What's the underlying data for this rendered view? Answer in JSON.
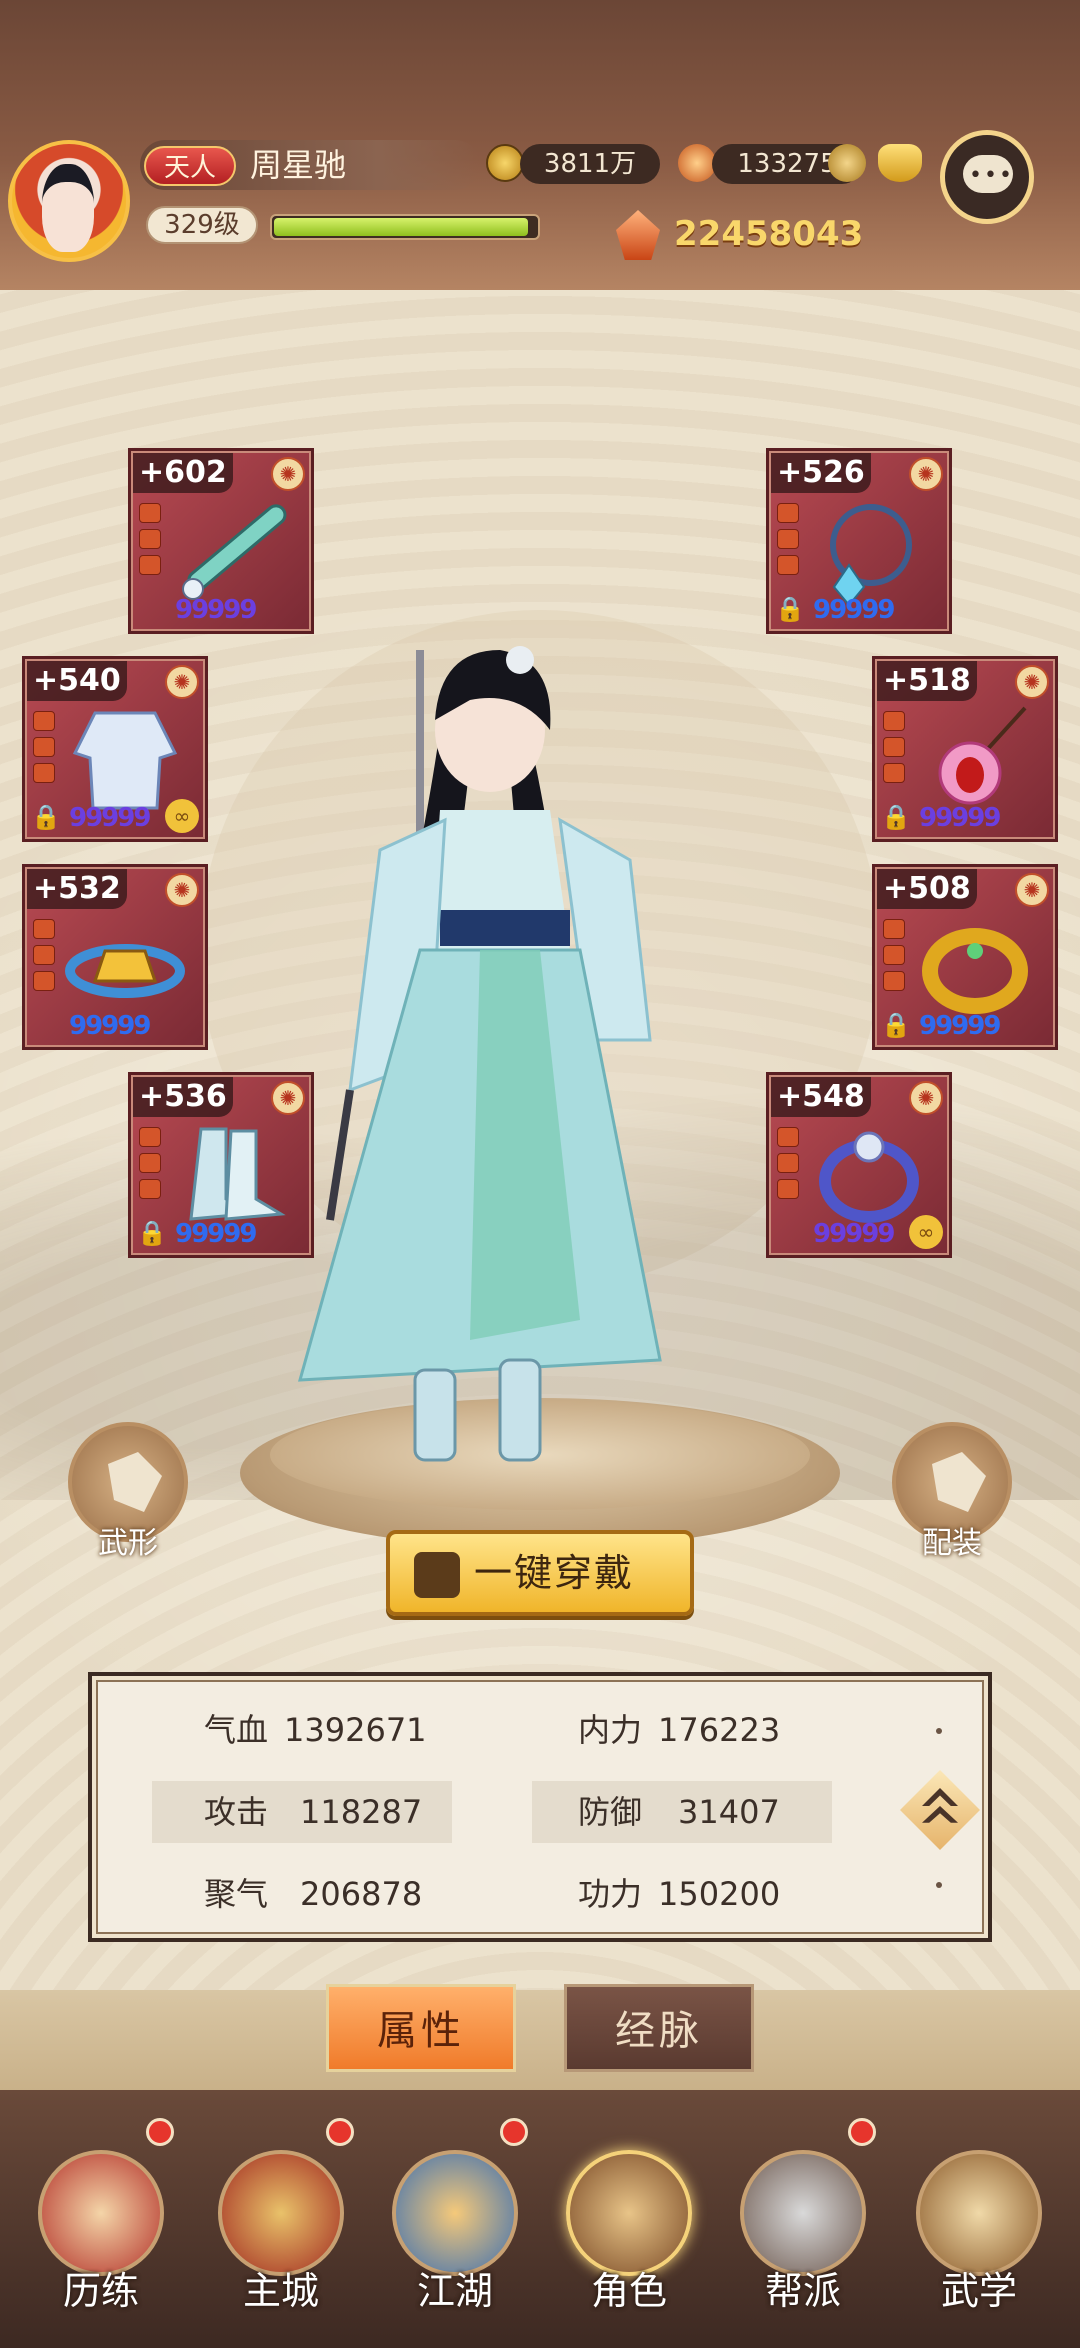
{
  "header": {
    "rank": "天人",
    "player_name": "周星驰",
    "level": "329级",
    "xp_fraction": 0.97,
    "coins": "3811万",
    "gems": "133275",
    "power": "22458043"
  },
  "equipment": {
    "left": [
      {
        "level": "+602",
        "name": "weapon-flute"
      },
      {
        "level": "+540",
        "name": "robe"
      },
      {
        "level": "+532",
        "name": "belt"
      },
      {
        "level": "+536",
        "name": "boots"
      }
    ],
    "right": [
      {
        "level": "+526",
        "name": "bracelet"
      },
      {
        "level": "+518",
        "name": "necklace"
      },
      {
        "level": "+508",
        "name": "armlet"
      },
      {
        "level": "+548",
        "name": "ring"
      }
    ]
  },
  "buttons": {
    "form": "武形",
    "outfit": "配装",
    "equip_all": "一键穿戴"
  },
  "stats": [
    {
      "label": "气血",
      "value": "1392671"
    },
    {
      "label": "内力",
      "value": "176223"
    },
    {
      "label": "攻击",
      "value": "118287"
    },
    {
      "label": "防御",
      "value": "31407"
    },
    {
      "label": "聚气",
      "value": "206878"
    },
    {
      "label": "功力",
      "value": "150200"
    }
  ],
  "tabs": [
    {
      "label": "属性",
      "active": true
    },
    {
      "label": "经脉",
      "active": false
    }
  ],
  "nav": [
    {
      "label": "历练",
      "badge": true
    },
    {
      "label": "主城",
      "badge": true
    },
    {
      "label": "江湖",
      "badge": true
    },
    {
      "label": "角色",
      "badge": false,
      "active": true
    },
    {
      "label": "帮派",
      "badge": true
    },
    {
      "label": "武学",
      "badge": false
    }
  ],
  "colors": {
    "card": "#b84a52",
    "accent_gold": "#f0b52a",
    "active_tab": "#f07b2a"
  }
}
